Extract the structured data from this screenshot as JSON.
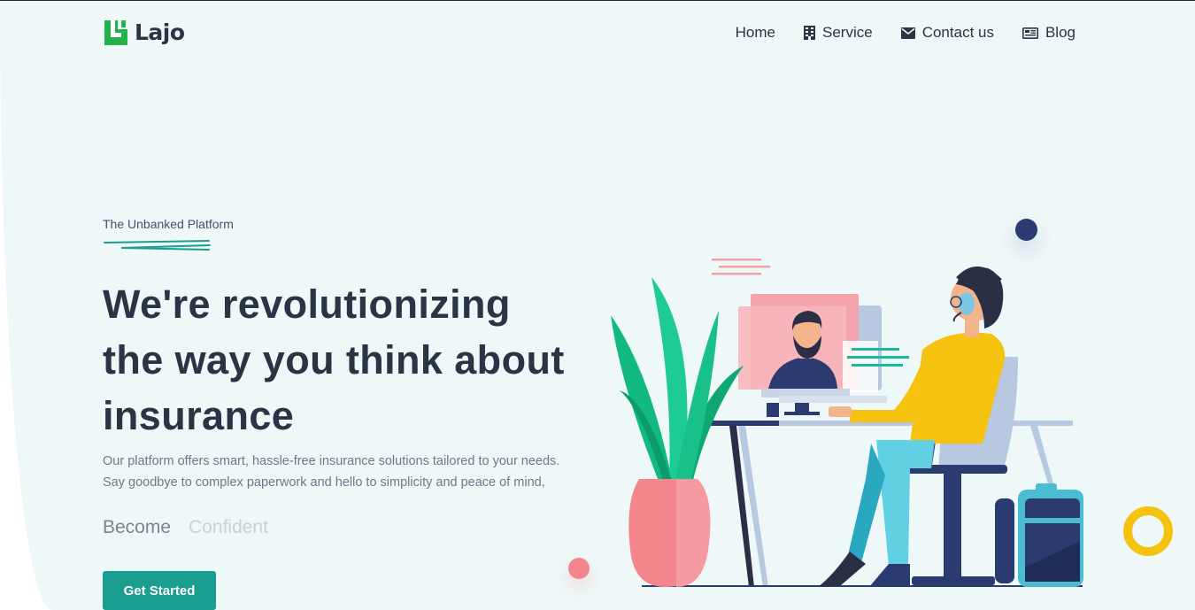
{
  "brand": {
    "name": "Lajo",
    "icon": "lajo-logo-icon"
  },
  "nav": {
    "items": [
      {
        "label": "Home",
        "icon": ""
      },
      {
        "label": "Service",
        "icon": "building-icon"
      },
      {
        "label": "Contact us",
        "icon": "envelope-icon"
      },
      {
        "label": "Blog",
        "icon": "newspaper-icon"
      }
    ]
  },
  "hero": {
    "tagline": "The Unbanked Platform",
    "headline": [
      "We're revolutionizing",
      "the way you think about",
      "insurance"
    ],
    "description": [
      "Our platform offers smart, hassle-free insurance solutions tailored to your needs.",
      "Say goodbye to complex paperwork and hello to simplicity and peace of mind,"
    ],
    "rotator": {
      "static": "Become",
      "word": "Confident"
    },
    "cta_label": "Get Started"
  },
  "colors": {
    "accent": "#1a9e8f",
    "heading": "#2a3444",
    "background": "#eff8f8",
    "logo_green": "#22b24c",
    "yellow": "#f5c20f",
    "pink": "#f4858c",
    "navy": "#2b3a70"
  }
}
